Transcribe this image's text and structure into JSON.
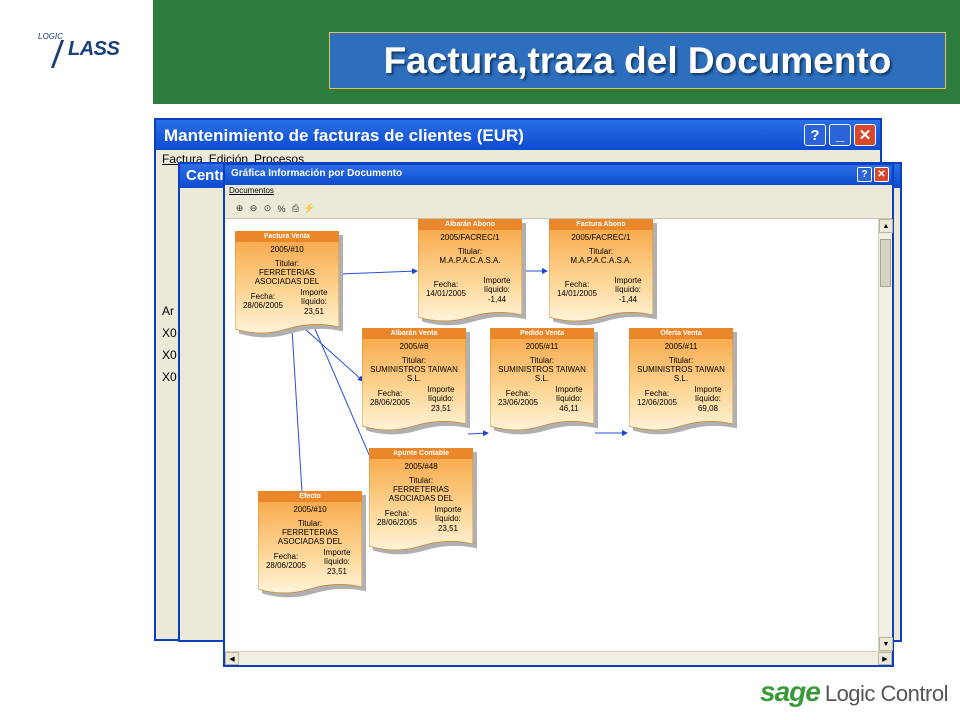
{
  "slide": {
    "title": "Factura,traza del Documento",
    "logo_left_small": "LOGIC",
    "logo_left_big": "LASS",
    "logo_right_sage": "sage",
    "logo_right_text": "Logic Control"
  },
  "back_window": {
    "title": "Mantenimiento de facturas de clientes (EUR)",
    "menu": [
      "Factura",
      "Edición",
      "Procesos"
    ],
    "left_labels": [
      "Ar",
      "X0",
      "X0",
      "X0"
    ]
  },
  "mid_window": {
    "title": "Centr"
  },
  "front_window": {
    "title": "Gráfica Información por Documento",
    "menu_item": "Documentos",
    "tools": [
      "zoom-in-icon",
      "zoom-out-icon",
      "zoom-reset-icon",
      "percent-icon",
      "print-icon",
      "export-icon"
    ],
    "tool_glyphs": [
      "⊕",
      "⊖",
      "⊙",
      "%",
      "⎙",
      "⚡"
    ]
  },
  "card_labels": {
    "titular": "Titular:",
    "fecha": "Fecha:",
    "importe": "Importe líquido:"
  },
  "documents": [
    {
      "id": "factura",
      "type": "Factura Venta",
      "number": "2005/#10",
      "holder": "FERRETERIAS ASOCIADAS DEL MEDITERRANEO",
      "date": "28/06/2005",
      "amount": "23,51"
    },
    {
      "id": "albaran-abono",
      "type": "Albarán Abono",
      "number": "2005/FACREC/1",
      "holder": "M.A.P.A.C.A.S.A.",
      "date": "14/01/2005",
      "amount": "-1,44"
    },
    {
      "id": "factura-abono",
      "type": "Factura Abono",
      "number": "2005/FACREC/1",
      "holder": "M.A.P.A.C.A.S.A.",
      "date": "14/01/2005",
      "amount": "-1,44"
    },
    {
      "id": "albaran-venta",
      "type": "Albarán Venta",
      "number": "2005/#8",
      "holder": "SUMINISTROS TAIWAN S.L.",
      "date": "28/06/2005",
      "amount": "23,51"
    },
    {
      "id": "pedido-venta",
      "type": "Pedido Venta",
      "number": "2005/#11",
      "holder": "SUMINISTROS TAIWAN S.L.",
      "date": "23/06/2005",
      "amount": "46,11"
    },
    {
      "id": "oferta-venta",
      "type": "Oferta Venta",
      "number": "2005/#11",
      "holder": "SUMINISTROS TAIWAN S.L.",
      "date": "12/06/2005",
      "amount": "69,08"
    },
    {
      "id": "apunte",
      "type": "Apunte Contable",
      "number": "2005/#48",
      "holder": "FERRETERIAS ASOCIADAS DEL MEDITERRANEO",
      "date": "28/06/2005",
      "amount": "23,51"
    },
    {
      "id": "efecto",
      "type": "Efecto",
      "number": "2005/#10",
      "holder": "FERRETERIAS ASOCIADAS DEL MEDITERRANEO",
      "date": "28/06/2005",
      "amount": "23,51"
    }
  ]
}
